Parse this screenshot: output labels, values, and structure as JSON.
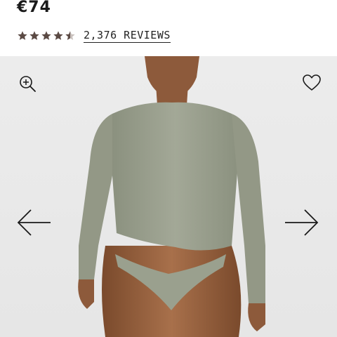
{
  "product": {
    "price": "€74"
  },
  "rating": {
    "score": 4.5,
    "max": 5,
    "reviews_label": "2,376 REVIEWS",
    "star_color": "#5b4a44"
  },
  "gallery": {
    "zoom_icon": "zoom-in-icon",
    "wishlist_icon": "heart-outline-icon",
    "prev_icon": "arrow-left-icon",
    "next_icon": "arrow-right-icon",
    "background_color": "#e9e9e9",
    "garment_color": "#9aa08e"
  }
}
